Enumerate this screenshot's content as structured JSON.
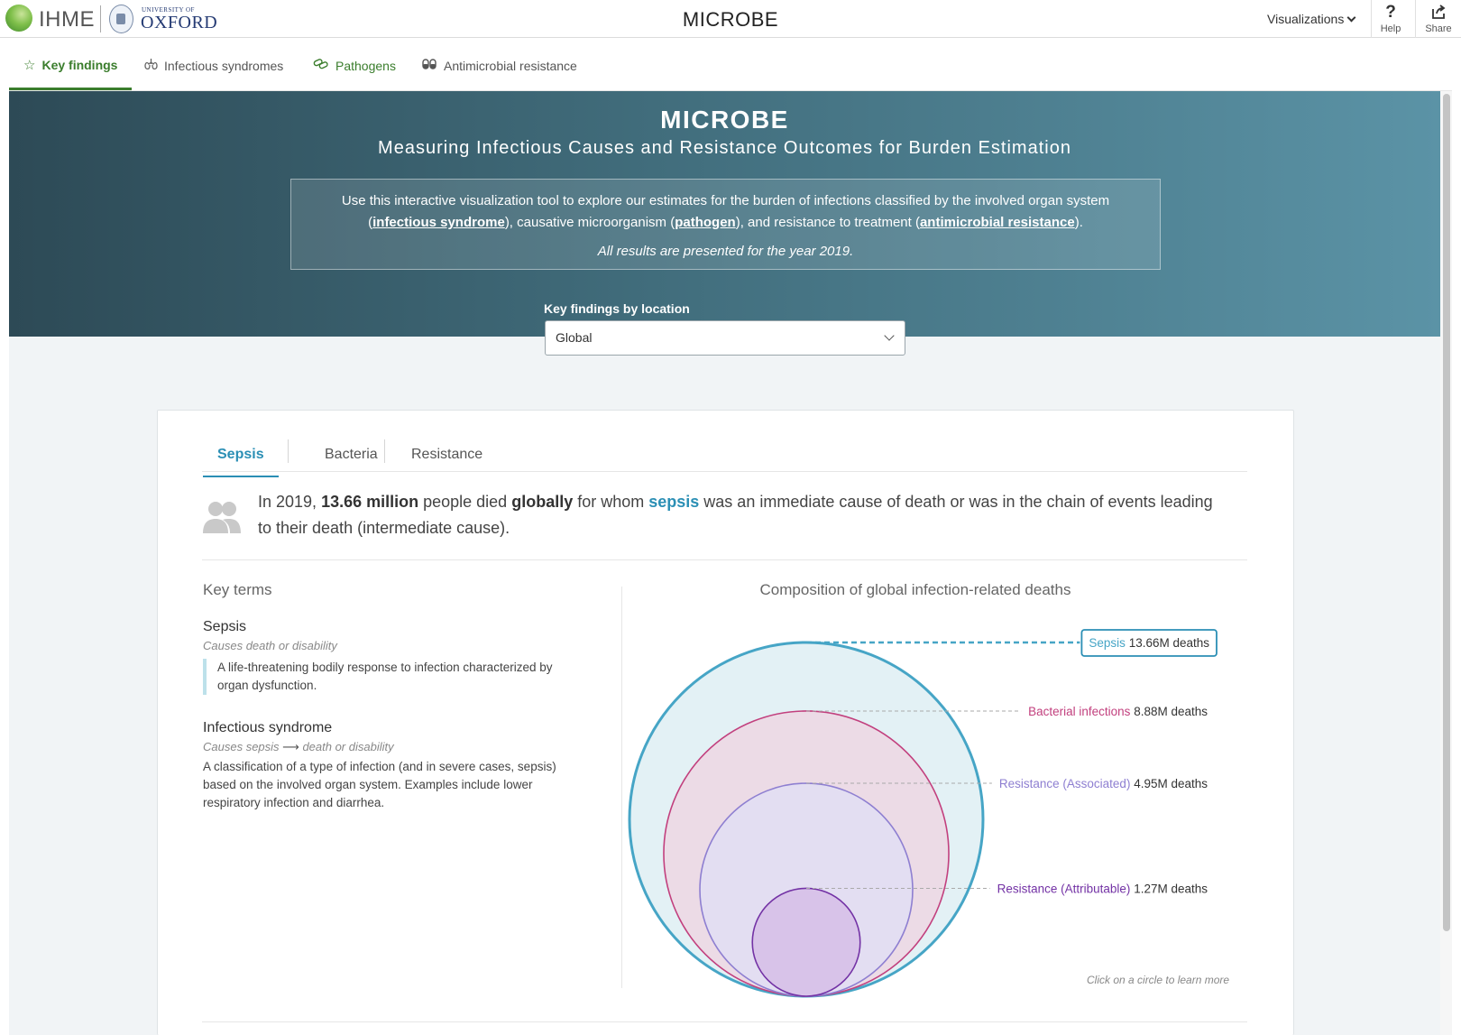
{
  "topbar": {
    "ihme_logo_text": "IHME",
    "oxford_univ_text": "UNIVERSITY OF",
    "oxford_name_text": "OXFORD",
    "app_title": "MICROBE",
    "visualizations_label": "Visualizations",
    "help_label": "Help",
    "share_label": "Share"
  },
  "nav": {
    "tabs": [
      {
        "label": "Key findings",
        "icon": "star-outline-icon",
        "active": true
      },
      {
        "label": "Infectious syndromes",
        "icon": "lungs-icon",
        "active": false
      },
      {
        "label": "Pathogens",
        "icon": "bacteria-icon",
        "active": false
      },
      {
        "label": "Antimicrobial resistance",
        "icon": "pills-icon",
        "active": false
      }
    ]
  },
  "hero": {
    "title": "MICROBE",
    "subtitle": "Measuring Infectious Causes and Resistance Outcomes for Burden Estimation",
    "intro_a": "Use this interactive visualization tool to explore our estimates for the burden of infections classified by the involved organ system (",
    "link_syndrome": "infectious syndrome",
    "intro_b": "), causative microorganism (",
    "link_pathogen": "pathogen",
    "intro_c": "), and resistance to treatment (",
    "link_amr": "antimicrobial resistance",
    "intro_d": ").",
    "year_note": "All results are presented for the year 2019.",
    "location_label": "Key findings by location",
    "location_value": "Global"
  },
  "card": {
    "tabs": [
      "Sepsis",
      "Bacteria",
      "Resistance"
    ],
    "active_tab": "Sepsis",
    "summary": {
      "p1": "In 2019, ",
      "deaths": "13.66 million",
      "p2": " people died ",
      "scope": "globally",
      "p3": " for whom ",
      "term": "sepsis",
      "p4": " was an immediate cause of death or was in the chain of events leading to their death (intermediate cause)."
    },
    "key_terms_title": "Key terms",
    "terms": [
      {
        "name": "Sepsis",
        "meta": "Causes death or disability",
        "definition": "A life-threatening bodily response to infection characterized by organ dysfunction."
      },
      {
        "name": "Infectious syndrome",
        "meta_a": "Causes sepsis",
        "meta_b": "death or disability",
        "definition": "A classification of a type of infection (and in severe cases, sepsis) based on the involved organ system. Examples include lower respiratory infection and diarrhea."
      }
    ],
    "chart_hint": "Click on a circle to learn more"
  },
  "chart_data": {
    "type": "nested-circles",
    "title": "Composition of global infection-related deaths",
    "unit": "deaths",
    "series": [
      {
        "name": "Sepsis",
        "value": 13.66,
        "display": "13.66M deaths",
        "color": "#46a5c6",
        "fill": "#e3f1f5"
      },
      {
        "name": "Bacterial infections",
        "value": 8.88,
        "display": "8.88M deaths",
        "color": "#c2407e",
        "fill": "#ecdbe6"
      },
      {
        "name": "Resistance (Associated)",
        "value": 4.95,
        "display": "4.95M deaths",
        "color": "#8e7fd1",
        "fill": "#e3def2"
      },
      {
        "name": "Resistance (Attributable)",
        "value": 1.27,
        "display": "1.27M deaths",
        "color": "#7332a5",
        "fill": "#d8c3e9"
      }
    ]
  }
}
